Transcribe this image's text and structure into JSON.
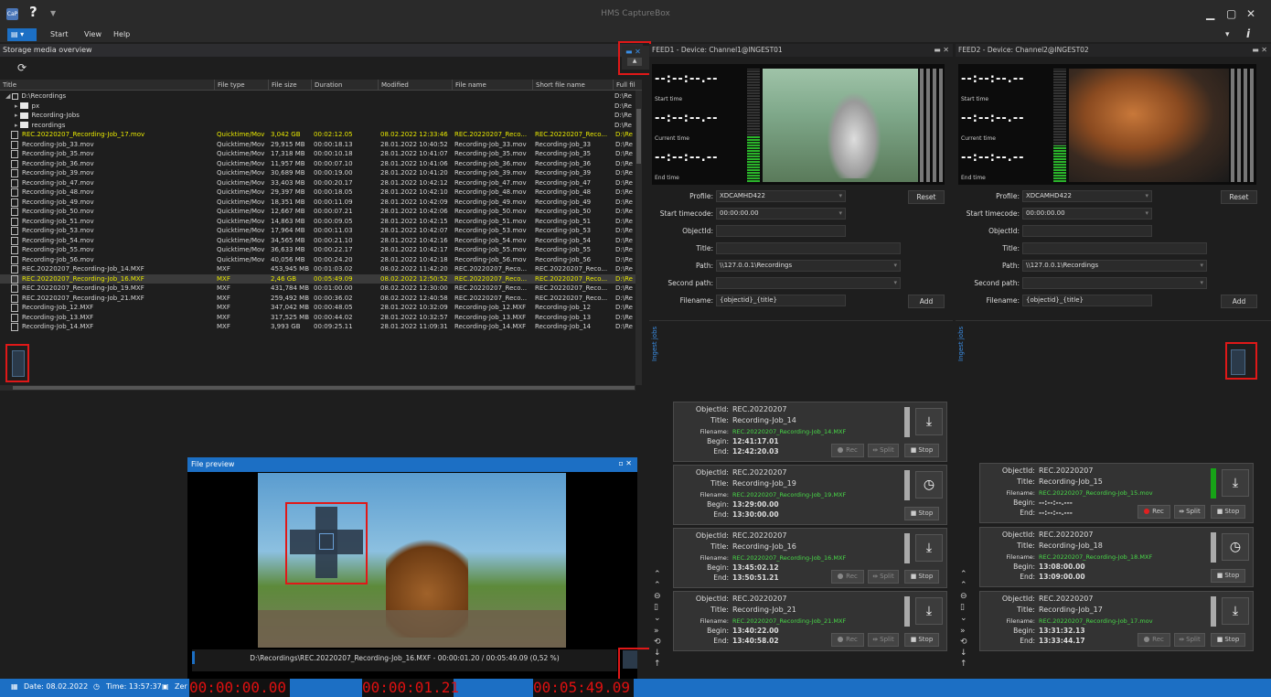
{
  "app": {
    "title": "HMS CaptureBox",
    "icon_label": "CaP"
  },
  "menu": {
    "items": [
      "Start",
      "View",
      "Help"
    ]
  },
  "storage": {
    "title": "Storage media overview",
    "columns": [
      "Title",
      "File type",
      "File size",
      "Duration",
      "Modified",
      "File name",
      "Short file name",
      "Full file p"
    ],
    "tree": [
      {
        "label": "D:\\Recordings",
        "path": "D:\\Re"
      },
      {
        "label": "px",
        "path": "D:\\Re"
      },
      {
        "label": "Recording-Jobs",
        "path": "D:\\Re"
      },
      {
        "label": "recordings",
        "path": "D:\\Re"
      }
    ],
    "rows": [
      [
        "REC.20220207_Recording-Job_17.mov",
        "Quicktime/Mov",
        "3,042 GB",
        "00:02:12.05",
        "08.02.2022 12:33:46",
        "REC.20220207_Reco...",
        "REC.20220207_Reco...",
        "D:\\Re",
        "y"
      ],
      [
        "Recording-Job_33.mov",
        "Quicktime/Mov",
        "29,915 MB",
        "00:00:18.13",
        "28.01.2022 10:40:52",
        "Recording-Job_33.mov",
        "Recording-Job_33",
        "D:\\Re",
        ""
      ],
      [
        "Recording-Job_35.mov",
        "Quicktime/Mov",
        "17,318 MB",
        "00:00:10.18",
        "28.01.2022 10:41:07",
        "Recording-Job_35.mov",
        "Recording-Job_35",
        "D:\\Re",
        ""
      ],
      [
        "Recording-Job_36.mov",
        "Quicktime/Mov",
        "11,957 MB",
        "00:00:07.10",
        "28.01.2022 10:41:06",
        "Recording-Job_36.mov",
        "Recording-Job_36",
        "D:\\Re",
        ""
      ],
      [
        "Recording-Job_39.mov",
        "Quicktime/Mov",
        "30,689 MB",
        "00:00:19.00",
        "28.01.2022 10:41:20",
        "Recording-Job_39.mov",
        "Recording-Job_39",
        "D:\\Re",
        ""
      ],
      [
        "Recording-Job_47.mov",
        "Quicktime/Mov",
        "33,403 MB",
        "00:00:20.17",
        "28.01.2022 10:42:12",
        "Recording-Job_47.mov",
        "Recording-Job_47",
        "D:\\Re",
        ""
      ],
      [
        "Recording-Job_48.mov",
        "Quicktime/Mov",
        "29,397 MB",
        "00:00:18.05",
        "28.01.2022 10:42:10",
        "Recording-Job_48.mov",
        "Recording-Job_48",
        "D:\\Re",
        ""
      ],
      [
        "Recording-Job_49.mov",
        "Quicktime/Mov",
        "18,351 MB",
        "00:00:11.09",
        "28.01.2022 10:42:09",
        "Recording-Job_49.mov",
        "Recording-Job_49",
        "D:\\Re",
        ""
      ],
      [
        "Recording-Job_50.mov",
        "Quicktime/Mov",
        "12,667 MB",
        "00:00:07.21",
        "28.01.2022 10:42:06",
        "Recording-Job_50.mov",
        "Recording-Job_50",
        "D:\\Re",
        ""
      ],
      [
        "Recording-Job_51.mov",
        "Quicktime/Mov",
        "14,863 MB",
        "00:00:09.05",
        "28.01.2022 10:42:15",
        "Recording-Job_51.mov",
        "Recording-Job_51",
        "D:\\Re",
        ""
      ],
      [
        "Recording-Job_53.mov",
        "Quicktime/Mov",
        "17,964 MB",
        "00:00:11.03",
        "28.01.2022 10:42:07",
        "Recording-Job_53.mov",
        "Recording-Job_53",
        "D:\\Re",
        ""
      ],
      [
        "Recording-Job_54.mov",
        "Quicktime/Mov",
        "34,565 MB",
        "00:00:21.10",
        "28.01.2022 10:42:16",
        "Recording-Job_54.mov",
        "Recording-Job_54",
        "D:\\Re",
        ""
      ],
      [
        "Recording-Job_55.mov",
        "Quicktime/Mov",
        "36,633 MB",
        "00:00:22.17",
        "28.01.2022 10:42:17",
        "Recording-Job_55.mov",
        "Recording-Job_55",
        "D:\\Re",
        ""
      ],
      [
        "Recording-Job_56.mov",
        "Quicktime/Mov",
        "40,056 MB",
        "00:00:24.20",
        "28.01.2022 10:42:18",
        "Recording-Job_56.mov",
        "Recording-Job_56",
        "D:\\Re",
        ""
      ],
      [
        "REC.20220207_Recording-Job_14.MXF",
        "MXF",
        "453,945 MB",
        "00:01:03.02",
        "08.02.2022 11:42:20",
        "REC.20220207_Reco...",
        "REC.20220207_Reco...",
        "D:\\Re",
        ""
      ],
      [
        "REC.20220207_Recording-Job_16.MXF",
        "MXF",
        "2,46 GB",
        "00:05:49.09",
        "08.02.2022 12:50:52",
        "REC.20220207_Reco...",
        "REC.20220207_Reco...",
        "D:\\Re",
        "ys"
      ],
      [
        "REC.20220207_Recording-Job_19.MXF",
        "MXF",
        "431,784 MB",
        "00:01:00.00",
        "08.02.2022 12:30:00",
        "REC.20220207_Reco...",
        "REC.20220207_Reco...",
        "D:\\Re",
        ""
      ],
      [
        "REC.20220207_Recording-Job_21.MXF",
        "MXF",
        "259,492 MB",
        "00:00:36.02",
        "08.02.2022 12:40:58",
        "REC.20220207_Reco...",
        "REC.20220207_Reco...",
        "D:\\Re",
        ""
      ],
      [
        "Recording-Job_12.MXF",
        "MXF",
        "347,042 MB",
        "00:00:48.05",
        "28.01.2022 10:32:09",
        "Recording-Job_12.MXF",
        "Recording-Job_12",
        "D:\\Re",
        ""
      ],
      [
        "Recording-Job_13.MXF",
        "MXF",
        "317,525 MB",
        "00:00:44.02",
        "28.01.2022 10:32:57",
        "Recording-Job_13.MXF",
        "Recording-Job_13",
        "D:\\Re",
        ""
      ],
      [
        "Recording-Job_14.MXF",
        "MXF",
        "3,993 GB",
        "00:09:25.11",
        "28.01.2022 11:09:31",
        "Recording-Job_14.MXF",
        "Recording-Job_14",
        "D:\\Re",
        ""
      ]
    ]
  },
  "preview": {
    "title": "File preview",
    "path_text": "D:\\Recordings\\REC.20220207_Recording-Job_16.MXF - 00:00:01.20 / 00:05:49.09 (0,52 %)",
    "progress": 0.0052
  },
  "feed1": {
    "title": "FEED1 - Device: Channel1@INGEST01",
    "tc_value": "--:--:--.--",
    "tc_labels": [
      "Start time",
      "Current time",
      "End time"
    ],
    "profile": "XDCAMHD422",
    "start_tc": "00:00:00.00",
    "objectid": "",
    "title_val": "",
    "path": "\\\\127.0.0.1\\Recordings",
    "second_path": "",
    "filename": "{objectid}_{title}",
    "reset": "Reset",
    "add": "Add",
    "labels": {
      "profile": "Profile:",
      "start_tc": "Start timecode:",
      "objectid": "ObjectId:",
      "title": "Title:",
      "path": "Path:",
      "second_path": "Second path:",
      "filename": "Filename:"
    },
    "jobs_tab": "Ingest jobs",
    "jobs": [
      {
        "objectid": "REC.20220207",
        "title": "Recording-Job_14",
        "filename": "REC.20220207_Recording-Job_14.MXF",
        "begin": "12:41:17.01",
        "end": "12:42:20.03",
        "icon": "download",
        "buttons": true
      },
      {
        "objectid": "REC.20220207",
        "title": "Recording-Job_19",
        "filename": "REC.20220207_Recording-Job_19.MXF",
        "begin": "13:29:00.00",
        "end": "13:30:00.00",
        "icon": "clock",
        "buttons": false
      },
      {
        "objectid": "REC.20220207",
        "title": "Recording-Job_16",
        "filename": "REC.20220207_Recording-Job_16.MXF",
        "begin": "13:45:02.12",
        "end": "13:50:51.21",
        "icon": "download",
        "buttons": true
      },
      {
        "objectid": "REC.20220207",
        "title": "Recording-Job_21",
        "filename": "REC.20220207_Recording-Job_21.MXF",
        "begin": "13:40:22.00",
        "end": "13:40:58.02",
        "icon": "download",
        "buttons": true
      }
    ]
  },
  "feed2": {
    "title": "FEED2 - Device: Channel2@INGEST02",
    "profile": "XDCAMHD422",
    "start_tc": "00:00:00.00",
    "path": "\\\\127.0.0.1\\Recordings",
    "filename": "{objectid}_{title}",
    "jobs": [
      {
        "objectid": "REC.20220207",
        "title": "Recording-Job_15",
        "filename": "REC.20220207_Recording-Job_15.mov",
        "begin": "--:--:--.---",
        "end": "--:--:--.---",
        "icon": "download",
        "buttons": true,
        "recording": true
      },
      {
        "objectid": "REC.20220207",
        "title": "Recording-Job_18",
        "filename": "REC.20220207_Recording-Job_18.MXF",
        "begin": "13:08:00.00",
        "end": "13:09:00.00",
        "icon": "clock",
        "buttons": false
      },
      {
        "objectid": "REC.20220207",
        "title": "Recording-Job_17",
        "filename": "REC.20220207_Recording-Job_17.mov",
        "begin": "13:31:32.13",
        "end": "13:33:44.17",
        "icon": "download",
        "buttons": true
      }
    ]
  },
  "job_labels": {
    "objectid": "ObjectId:",
    "title": "Title:",
    "filename": "Filename:",
    "begin": "Begin:",
    "end": "End:",
    "rec": "Rec",
    "split": "Split",
    "stop": "Stop"
  },
  "status": {
    "date": "Date: 08.02.2022",
    "time": "Time: 13:57:37",
    "zer": "Zer",
    "tc1": "00:00:00.00",
    "tc2": "00:00:01.21",
    "tc3": "00:05:49.09"
  }
}
